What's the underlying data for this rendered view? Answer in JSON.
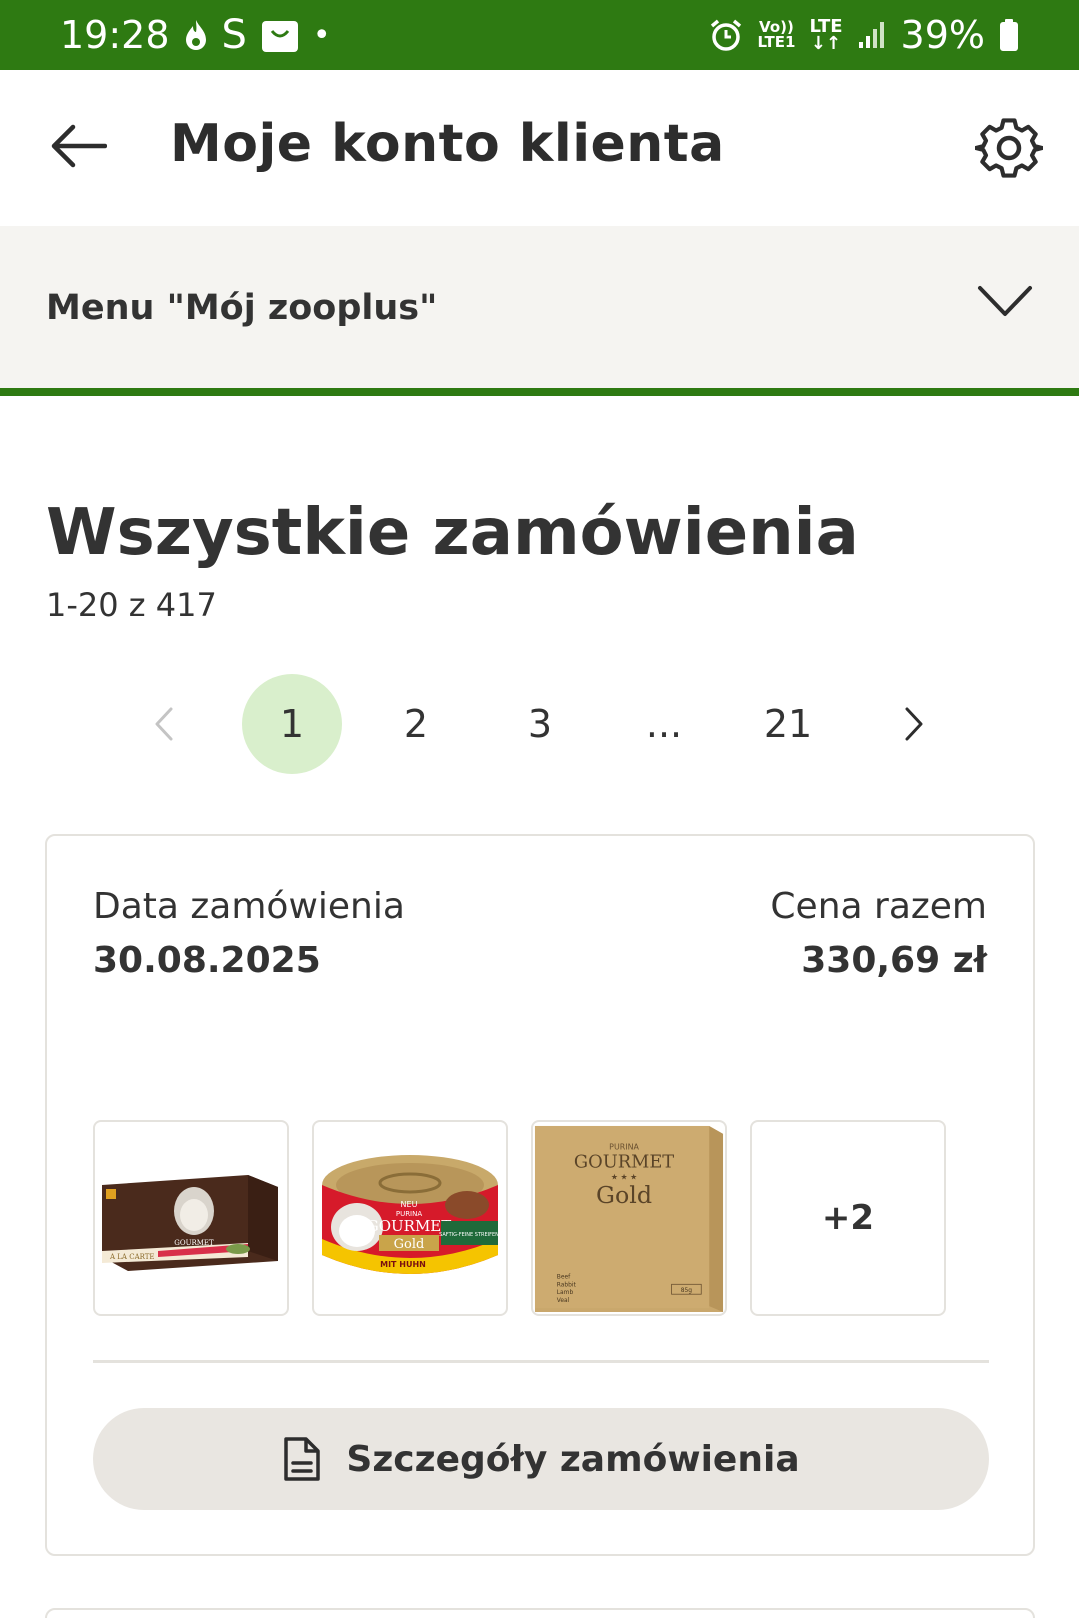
{
  "status_bar": {
    "time": "19:28",
    "s_label": "S",
    "dot": "•",
    "volte_line1": "Vo))",
    "volte_line2": "LTE1",
    "lte_line1": "LTE",
    "lte_line2": "↓↑",
    "battery": "39%",
    "icons": [
      "flame-icon",
      "s-app-icon",
      "shopping-bag-icon",
      "notification-dot",
      "alarm-icon",
      "signal-icon",
      "battery-icon"
    ]
  },
  "app_bar": {
    "title": "Moje konto klienta",
    "back_icon": "arrow-left-icon",
    "settings_icon": "gear-icon"
  },
  "menu": {
    "label": "Menu \"Mój zooplus\"",
    "chevron_icon": "chevron-down-icon"
  },
  "orders": {
    "heading": "Wszystkie zamówienia",
    "count": "1-20 z 417"
  },
  "pagination": {
    "prev_icon": "chevron-left-icon",
    "next_icon": "chevron-right-icon",
    "pages": [
      "1",
      "2",
      "3",
      "...",
      "21"
    ],
    "active": "1"
  },
  "order_card": {
    "date_label": "Data zamówienia",
    "date_value": "30.08.2025",
    "price_label": "Cena razem",
    "price_value": "330,69 zł",
    "more_items": "+2",
    "details_button": "Szczegóły zamówienia",
    "details_icon": "document-icon",
    "products": {
      "alacarte": {
        "brand": "GOURMET",
        "line": "A LA CARTE"
      },
      "can": {
        "top": "NEU",
        "purina": "PURINA",
        "brand": "GOURMET",
        "line": "Gold",
        "flavor": "MIT HUHN",
        "side": "SAFTIG-FEINE STREIFEN"
      },
      "box": {
        "purina": "PURINA",
        "brand": "GOURMET",
        "stars": "★ ★ ★",
        "line": "Gold",
        "list": [
          "Beef",
          "Rabbit",
          "Lamb",
          "Veal"
        ],
        "weight": "85g"
      }
    }
  },
  "colors": {
    "brand_green": "#2e7a12",
    "active_page": "#d9efcc",
    "menu_bg": "#f5f4f1",
    "button_bg": "#e9e6e1",
    "border": "#e4e2dd"
  }
}
